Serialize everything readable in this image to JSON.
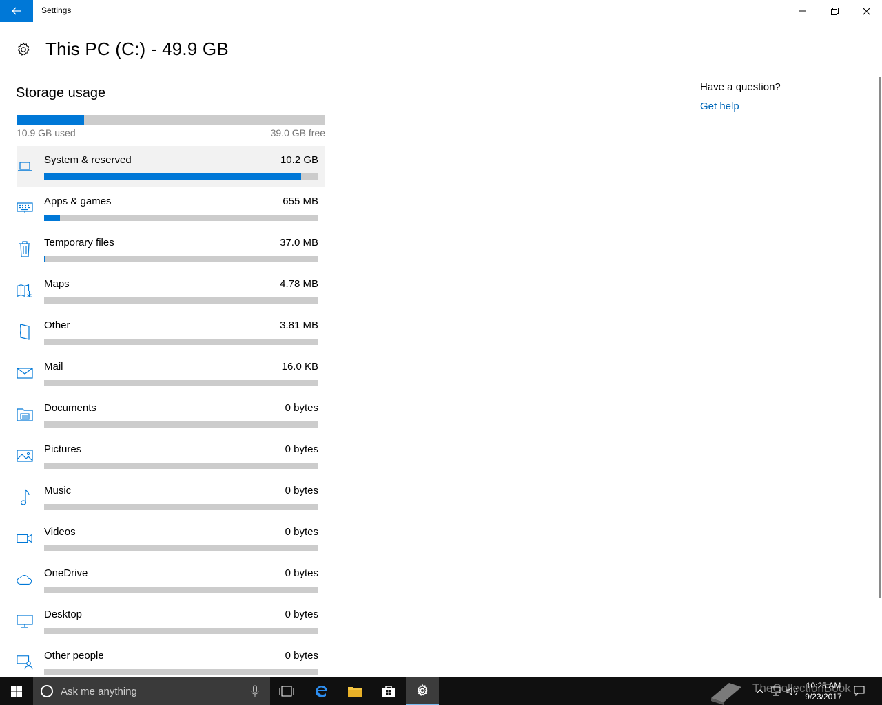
{
  "window": {
    "title": "Settings"
  },
  "page": {
    "title": "This PC (C:) - 49.9 GB"
  },
  "storage": {
    "section_title": "Storage usage",
    "used_label": "10.9 GB used",
    "free_label": "39.0 GB free",
    "used_fraction": 0.218
  },
  "categories": [
    {
      "name": "System & reserved",
      "size": "10.2 GB",
      "fraction": 0.938,
      "icon": "laptop-icon",
      "selected": true
    },
    {
      "name": "Apps & games",
      "size": "655 MB",
      "fraction": 0.058,
      "icon": "keyboard-icon"
    },
    {
      "name": "Temporary files",
      "size": "37.0 MB",
      "fraction": 0.004,
      "icon": "trash-icon"
    },
    {
      "name": "Maps",
      "size": "4.78 MB",
      "fraction": 0,
      "icon": "map-download-icon"
    },
    {
      "name": "Other",
      "size": "3.81 MB",
      "fraction": 0,
      "icon": "other-document-icon"
    },
    {
      "name": "Mail",
      "size": "16.0 KB",
      "fraction": 0,
      "icon": "mail-icon"
    },
    {
      "name": "Documents",
      "size": "0 bytes",
      "fraction": 0,
      "icon": "documents-folder-icon"
    },
    {
      "name": "Pictures",
      "size": "0 bytes",
      "fraction": 0,
      "icon": "picture-icon"
    },
    {
      "name": "Music",
      "size": "0 bytes",
      "fraction": 0,
      "icon": "music-note-icon"
    },
    {
      "name": "Videos",
      "size": "0 bytes",
      "fraction": 0,
      "icon": "video-camera-icon"
    },
    {
      "name": "OneDrive",
      "size": "0 bytes",
      "fraction": 0,
      "icon": "cloud-icon"
    },
    {
      "name": "Desktop",
      "size": "0 bytes",
      "fraction": 0,
      "icon": "monitor-icon"
    },
    {
      "name": "Other people",
      "size": "0 bytes",
      "fraction": 0,
      "icon": "person-monitor-icon"
    }
  ],
  "help": {
    "question": "Have a question?",
    "link": "Get help"
  },
  "taskbar": {
    "search_placeholder": "Ask me anything",
    "time": "10:25 AM",
    "date": "9/23/2017",
    "watermark": "TheCollectionBook"
  },
  "colors": {
    "accent": "#0078d7",
    "bar_bg": "#cccccc",
    "link": "#0067b8",
    "taskbar": "#101010"
  }
}
